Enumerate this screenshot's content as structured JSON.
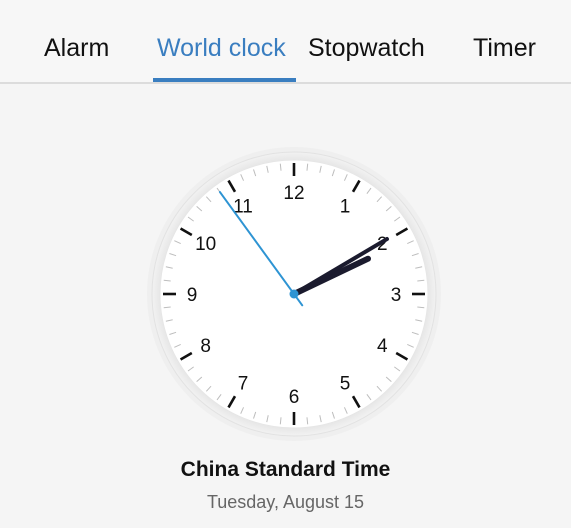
{
  "tabs": {
    "alarm": "Alarm",
    "world_clock": "World clock",
    "stopwatch": "Stopwatch",
    "timer": "Timer",
    "active": "world_clock"
  },
  "clock": {
    "numerals": [
      "12",
      "1",
      "2",
      "3",
      "4",
      "5",
      "6",
      "7",
      "8",
      "9",
      "10",
      "11"
    ],
    "time": {
      "hour": 2,
      "minute": 9,
      "second": 54
    },
    "colors": {
      "hour_minute_hand": "#1b1b2e",
      "second_hand": "#2e94d3",
      "accent": "#3a7ec0"
    }
  },
  "timezone": {
    "name": "China Standard Time",
    "date": "Tuesday, August 15"
  }
}
